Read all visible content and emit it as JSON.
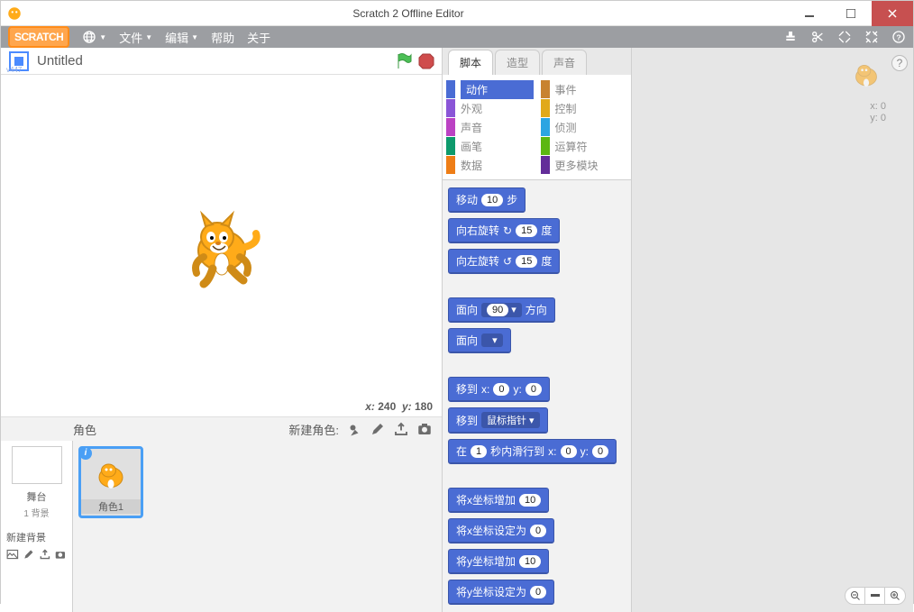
{
  "window": {
    "title": "Scratch 2 Offline Editor"
  },
  "menubar": {
    "logo": "SCRATCH",
    "items": [
      "文件",
      "编辑",
      "帮助",
      "关于"
    ]
  },
  "stage_header": {
    "version": "v447",
    "project_title": "Untitled"
  },
  "stage_readout": {
    "x_label": "x:",
    "x": "240",
    "y_label": "y:",
    "y": "180"
  },
  "sprite_bar": {
    "title": "角色",
    "new_sprite": "新建角色:"
  },
  "stage_thumb": {
    "label": "舞台",
    "sub": "1 背景",
    "new_bg": "新建背景"
  },
  "sprite1": {
    "name": "角色1"
  },
  "tabs": [
    "脚本",
    "造型",
    "声音"
  ],
  "categories": [
    {
      "label": "动作",
      "color": "#4a6cd4",
      "selected": true
    },
    {
      "label": "事件",
      "color": "#c88330"
    },
    {
      "label": "外观",
      "color": "#8a55d7"
    },
    {
      "label": "控制",
      "color": "#e1a91a"
    },
    {
      "label": "声音",
      "color": "#bb42c3"
    },
    {
      "label": "侦测",
      "color": "#2ca5e2"
    },
    {
      "label": "画笔",
      "color": "#0e9a6c"
    },
    {
      "label": "运算符",
      "color": "#5cb712"
    },
    {
      "label": "数据",
      "color": "#ee7d16"
    },
    {
      "label": "更多模块",
      "color": "#632d99"
    }
  ],
  "blocks": {
    "move": {
      "pre": "移动",
      "v": "10",
      "post": "步"
    },
    "turn_r": {
      "pre": "向右旋转",
      "icon": "↻",
      "v": "15",
      "post": "度"
    },
    "turn_l": {
      "pre": "向左旋转",
      "icon": "↺",
      "v": "15",
      "post": "度"
    },
    "point_dir": {
      "pre": "面向",
      "v": "90",
      "post": "方向"
    },
    "point_toward": {
      "pre": "面向"
    },
    "goto_xy": {
      "pre": "移到",
      "xl": "x:",
      "x": "0",
      "yl": "y:",
      "y": "0"
    },
    "goto_target": {
      "pre": "移到",
      "target": "鼠标指针"
    },
    "glide": {
      "pre": "在",
      "t": "1",
      "mid": "秒内滑行到",
      "xl": "x:",
      "x": "0",
      "yl": "y:",
      "y": "0"
    },
    "change_x": {
      "pre": "将x坐标增加",
      "v": "10"
    },
    "set_x": {
      "pre": "将x坐标设定为",
      "v": "0"
    },
    "change_y": {
      "pre": "将y坐标增加",
      "v": "10"
    },
    "set_y": {
      "pre": "将y坐标设定为",
      "v": "0"
    }
  },
  "script_area": {
    "x_label": "x:",
    "x": "0",
    "y_label": "y:",
    "y": "0"
  }
}
